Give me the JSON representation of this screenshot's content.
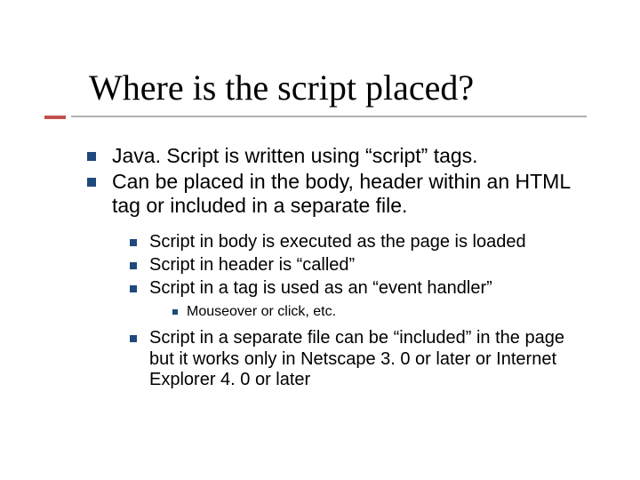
{
  "title": "Where is the script placed?",
  "bullets": {
    "l1a": "Java. Script is written using “script” tags.",
    "l1b": "Can be placed in the body, header within an HTML tag or included in a separate file.",
    "l2a": "Script in body is executed as the page is loaded",
    "l2b": "Script in header is “called”",
    "l2c": "Script in a tag is used as an “event handler”",
    "l3a": "Mouseover or click, etc.",
    "l2d": "Script in a separate file can be “included” in the page but it works only in Netscape 3. 0 or later or Internet Explorer 4. 0 or later"
  }
}
